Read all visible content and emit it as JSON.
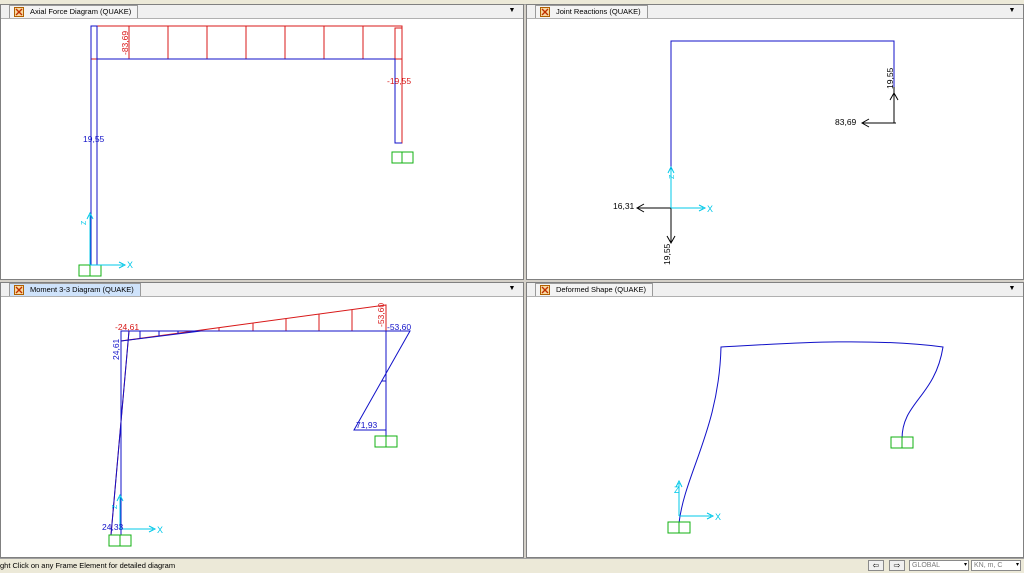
{
  "panes": {
    "axial": {
      "title": "Axial Force Diagram   (QUAKE)",
      "labels": {
        "beam_value": "-83,69",
        "right_col_value": "-19,55",
        "left_col_value": "19,55",
        "x_axis": "X",
        "z_axis": "Z"
      }
    },
    "joint": {
      "title": "Joint Reactions  (QUAKE)",
      "labels": {
        "right_vertical": "19,55",
        "right_horizontal": "83,69",
        "left_horizontal": "16,31",
        "left_vertical": "19,55",
        "x_axis": "X",
        "z_axis": "Z"
      }
    },
    "moment": {
      "title": "Moment 3-3 Diagram   (QUAKE)",
      "labels": {
        "top_left_red": "-24,61",
        "top_left_blue": "24,61",
        "top_right_red": "-53,60",
        "top_right_blue": "-53,60",
        "right_bottom": "71,93",
        "bottom_left": "24,33",
        "x_axis": "X",
        "z_axis": "Z"
      }
    },
    "deformed": {
      "title": "Deformed Shape (QUAKE)",
      "labels": {
        "x_axis": "X",
        "z_axis": "Z"
      }
    }
  },
  "dropdown_glyph": "▼",
  "statusbar": {
    "message": "ght Click on any Frame Element for detailed diagram",
    "prev_glyph": "⇦",
    "next_glyph": "⇨",
    "coord_system": "GLOBAL",
    "units": "KN, m, C",
    "select_arrow": "▾"
  },
  "colors": {
    "structure": "#1010c8",
    "axial_fill": "#d81818",
    "axis": "#00c8e8",
    "support": "#10b010",
    "reaction": "#000000"
  }
}
